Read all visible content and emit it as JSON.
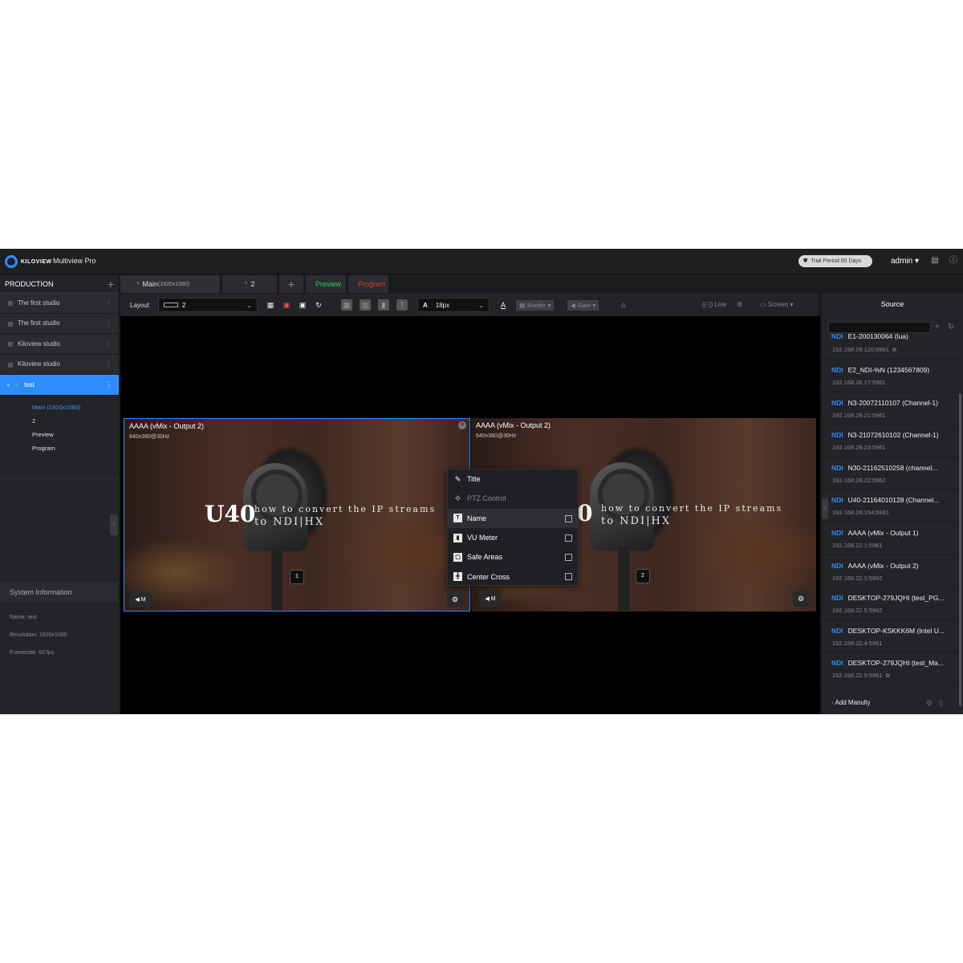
{
  "header": {
    "logo_text": "KILOVIEW",
    "app_title": "Multiview Pro",
    "trial_text": "Trial Period 60 Days",
    "user": "admin",
    "accent": "#2f8cff"
  },
  "sidebar": {
    "title": "PRODUCTION",
    "studios": [
      {
        "label": "The first studio"
      },
      {
        "label": "The first studio"
      },
      {
        "label": "Kiloview studio"
      },
      {
        "label": "Kiloview studio"
      },
      {
        "label": "test"
      }
    ],
    "sub_items": [
      "Main (1920x1080)",
      "2",
      "Preview",
      "Program"
    ],
    "system_info": {
      "title": "System Information",
      "name": "Name: test",
      "resolution": "Resolution: 1920x1080",
      "framerate": "Framerate: 60 fps"
    }
  },
  "tabs": {
    "main_label": "Main",
    "main_res": "(1920x1080)",
    "second_label": "2",
    "preview": "Preview",
    "program": "Program"
  },
  "toolbar": {
    "layout_label": "Layout",
    "layout_value": "2",
    "font_size": "18px",
    "border": "Border",
    "gain": "Gain",
    "live": "Live",
    "screen": "Screen"
  },
  "panes": [
    {
      "title": "AAAA (vMix - Output 2)",
      "sub": "640x360@30Hz",
      "number": "1",
      "big": "U40",
      "line1": "how to convert the IP streams",
      "line2": "to NDI|HX",
      "mute": "M"
    },
    {
      "title": "AAAA (vMix - Output 2)",
      "sub": "640x360@30Hz",
      "number": "2",
      "big": "0",
      "line1": "how to convert the IP streams",
      "line2": "to NDI|HX",
      "mute": "M"
    }
  ],
  "menu": {
    "items": [
      {
        "label": "Title",
        "icon": "edit-icon"
      },
      {
        "label": "PTZ Control",
        "icon": "move-icon"
      },
      {
        "label": "Name",
        "icon": "text-icon"
      },
      {
        "label": "VU Meter",
        "icon": "vu-icon"
      },
      {
        "label": "Safe Areas",
        "icon": "safe-areas-icon"
      },
      {
        "label": "Center Cross",
        "icon": "center-cross-icon"
      }
    ]
  },
  "source_panel": {
    "title": "Source",
    "badge": "NDI",
    "items": [
      {
        "name": "E1-200130064 (lua)",
        "ip": "192.168.28.120:5961"
      },
      {
        "name": "E2_NDI-%N (1234567809)",
        "ip": "192.168.28.27:5961"
      },
      {
        "name": "N3-20072110107 (Channel-1)",
        "ip": "192.168.28.21:5961"
      },
      {
        "name": "N3-21072610102 (Channel-1)",
        "ip": "192.168.28.23:5961"
      },
      {
        "name": "N30-21162510258 (channel...",
        "ip": "192.168.28.22:5962"
      },
      {
        "name": "U40-21164010128 (Channel...",
        "ip": "192.168.28.154:5961"
      },
      {
        "name": "AAAA (vMix - Output 1)",
        "ip": "192.168.22.1:5961"
      },
      {
        "name": "AAAA (vMix - Output 2)",
        "ip": "192.168.22.1:5962"
      },
      {
        "name": "DESKTOP-279JQHI (test_PG...",
        "ip": "192.168.22.5:5962"
      },
      {
        "name": "DESKTOP-KSKKK6M (Intel U...",
        "ip": "192.168.22.4:5961"
      },
      {
        "name": "DESKTOP-279JQHI (test_Ma...",
        "ip": "192.168.22.5:5961"
      }
    ],
    "add_manually": "Add Manully"
  }
}
